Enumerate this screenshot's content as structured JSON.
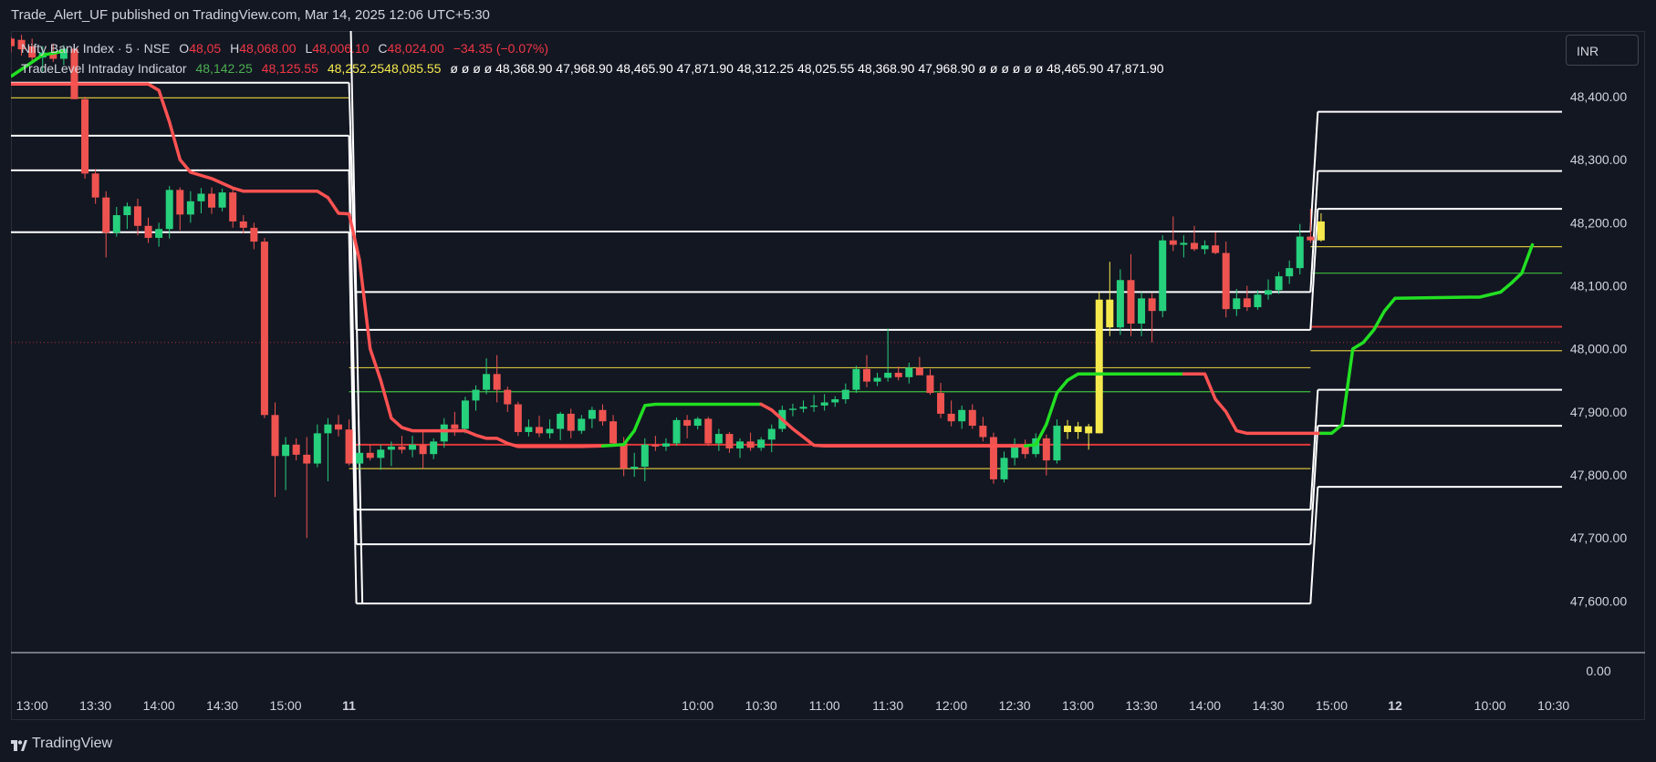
{
  "header": {
    "publish_line": "Trade_Alert_UF published on TradingView.com, Mar 14, 2025 12:06 UTC+5:30"
  },
  "legend": {
    "symbol": "Nifty Bank Index · 5 · NSE",
    "open_label": "O",
    "open_value": "48,05",
    "high_label": "H",
    "high_value": "48,068.00",
    "low_label": "L",
    "low_value": "48,006.10",
    "close_label": "C",
    "close_value": "48,024.00",
    "change": "−34.35 (−0.07%)",
    "indicator_name": "TradeLevel Intraday Indicator",
    "indicator_v1": "48,142.25",
    "indicator_v2": "48,125.55",
    "indicator_v3": "48,252.25",
    "indicator_v4": "48,085.55",
    "indicator_tail": "ø ø ø ø 48,368.90 47,968.90 48,465.90 47,871.90 48,312.25 48,025.55 48,368.90 47,968.90 ø ø ø ø ø ø 48,465.90 47,871.90"
  },
  "currency_button": {
    "label": "INR"
  },
  "footer": {
    "brand": "TradingView"
  },
  "colors": {
    "background": "#131722",
    "up_candle": "#26d07c",
    "down_candle": "#ef5350",
    "yellow_candle": "#f5e94e",
    "red_line": "#ff5252",
    "green_line": "#22e022",
    "level_white": "#ffffff",
    "level_yellow": "#d4c13a",
    "level_green": "#3fbf3f",
    "level_red": "#e03838"
  },
  "chart_data": {
    "type": "candlestick",
    "title": "",
    "xlabel": "",
    "ylabel": "",
    "ylim": [
      47500,
      48455
    ],
    "y_ticks": [
      48400,
      48300,
      48200,
      48100,
      48000,
      47900,
      47800,
      47700,
      47600
    ],
    "y_tick_labels": [
      "48,400.00",
      "48,300.00",
      "48,200.00",
      "48,100.00",
      "48,000.00",
      "47,900.00",
      "47,800.00",
      "47,700.00",
      "47,600.00"
    ],
    "indicator_pane_label": "0.00",
    "x_ticks": [
      {
        "label": "13:00",
        "bar": -54
      },
      {
        "label": "13:30",
        "bar": -48
      },
      {
        "label": "14:00",
        "bar": -42
      },
      {
        "label": "14:30",
        "bar": -36
      },
      {
        "label": "15:00",
        "bar": -30
      },
      {
        "label": "11",
        "bar": -24
      },
      {
        "label": "10:00",
        "bar": 9
      },
      {
        "label": "10:30",
        "bar": 15
      },
      {
        "label": "11:00",
        "bar": 21
      },
      {
        "label": "11:30",
        "bar": 27
      },
      {
        "label": "12:00",
        "bar": 33
      },
      {
        "label": "12:30",
        "bar": 39
      },
      {
        "label": "13:00",
        "bar": 45
      },
      {
        "label": "13:30",
        "bar": 51
      },
      {
        "label": "14:00",
        "bar": 57
      },
      {
        "label": "14:30",
        "bar": 63
      },
      {
        "label": "15:00",
        "bar": 69
      },
      {
        "label": "12",
        "bar": 75
      },
      {
        "label": "10:00",
        "bar": 84
      },
      {
        "label": "10:30",
        "bar": 90
      }
    ],
    "bar_first": -56,
    "bar_last": 93,
    "candles": [
      {
        "o": 48492,
        "h": 48495,
        "l": 48470,
        "c": 48480
      },
      {
        "o": 48490,
        "h": 48498,
        "l": 48465,
        "c": 48475
      },
      {
        "o": 48480,
        "h": 48492,
        "l": 48455,
        "c": 48462
      },
      {
        "o": 48462,
        "h": 48480,
        "l": 48440,
        "c": 48470
      },
      {
        "o": 48470,
        "h": 48484,
        "l": 48455,
        "c": 48460
      },
      {
        "o": 48460,
        "h": 48482,
        "l": 48450,
        "c": 48476
      },
      {
        "o": 48476,
        "h": 48484,
        "l": 48396,
        "c": 48396
      },
      {
        "o": 48396,
        "h": 48400,
        "l": 48270,
        "c": 48278
      },
      {
        "o": 48278,
        "h": 48285,
        "l": 48230,
        "c": 48240
      },
      {
        "o": 48240,
        "h": 48250,
        "l": 48145,
        "c": 48184
      },
      {
        "o": 48184,
        "h": 48225,
        "l": 48178,
        "c": 48212
      },
      {
        "o": 48212,
        "h": 48232,
        "l": 48190,
        "c": 48226
      },
      {
        "o": 48226,
        "h": 48238,
        "l": 48180,
        "c": 48195
      },
      {
        "o": 48195,
        "h": 48208,
        "l": 48168,
        "c": 48176
      },
      {
        "o": 48176,
        "h": 48200,
        "l": 48162,
        "c": 48190
      },
      {
        "o": 48190,
        "h": 48258,
        "l": 48175,
        "c": 48252
      },
      {
        "o": 48252,
        "h": 48256,
        "l": 48188,
        "c": 48213
      },
      {
        "o": 48213,
        "h": 48250,
        "l": 48200,
        "c": 48234
      },
      {
        "o": 48234,
        "h": 48255,
        "l": 48215,
        "c": 48246
      },
      {
        "o": 48246,
        "h": 48256,
        "l": 48214,
        "c": 48224
      },
      {
        "o": 48224,
        "h": 48254,
        "l": 48218,
        "c": 48248
      },
      {
        "o": 48248,
        "h": 48253,
        "l": 48192,
        "c": 48202
      },
      {
        "o": 48202,
        "h": 48212,
        "l": 48183,
        "c": 48192
      },
      {
        "o": 48192,
        "h": 48200,
        "l": 48158,
        "c": 48170
      },
      {
        "o": 48170,
        "h": 48176,
        "l": 47890,
        "c": 47895
      },
      {
        "o": 47895,
        "h": 47915,
        "l": 47765,
        "c": 47830
      },
      {
        "o": 47830,
        "h": 47860,
        "l": 47776,
        "c": 47848
      },
      {
        "o": 47848,
        "h": 47858,
        "l": 47823,
        "c": 47832
      },
      {
        "o": 47832,
        "h": 47860,
        "l": 47700,
        "c": 47818
      },
      {
        "o": 47818,
        "h": 47880,
        "l": 47812,
        "c": 47866
      },
      {
        "o": 47866,
        "h": 47890,
        "l": 47790,
        "c": 47880
      },
      {
        "o": 47880,
        "h": 47895,
        "l": 47861,
        "c": 47872
      },
      {
        "o": 47872,
        "h": 47888,
        "l": 47815,
        "c": 47818
      },
      {
        "o": 47818,
        "h": 47848,
        "l": 47808,
        "c": 47835
      },
      {
        "o": 47835,
        "h": 47848,
        "l": 47823,
        "c": 47827
      },
      {
        "o": 47827,
        "h": 47848,
        "l": 47808,
        "c": 47840
      },
      {
        "o": 47840,
        "h": 47853,
        "l": 47814,
        "c": 47845
      },
      {
        "o": 47845,
        "h": 47862,
        "l": 47834,
        "c": 47840
      },
      {
        "o": 47840,
        "h": 47862,
        "l": 47828,
        "c": 47848
      },
      {
        "o": 47848,
        "h": 47868,
        "l": 47810,
        "c": 47833
      },
      {
        "o": 47833,
        "h": 47858,
        "l": 47825,
        "c": 47853
      },
      {
        "o": 47853,
        "h": 47890,
        "l": 47843,
        "c": 47880
      },
      {
        "o": 47880,
        "h": 47900,
        "l": 47862,
        "c": 47873
      },
      {
        "o": 47873,
        "h": 47924,
        "l": 47866,
        "c": 47918
      },
      {
        "o": 47918,
        "h": 47942,
        "l": 47902,
        "c": 47935
      },
      {
        "o": 47935,
        "h": 47985,
        "l": 47928,
        "c": 47960
      },
      {
        "o": 47960,
        "h": 47990,
        "l": 47915,
        "c": 47935
      },
      {
        "o": 47935,
        "h": 47940,
        "l": 47900,
        "c": 47912
      },
      {
        "o": 47912,
        "h": 47916,
        "l": 47862,
        "c": 47868
      },
      {
        "o": 47868,
        "h": 47888,
        "l": 47861,
        "c": 47876
      },
      {
        "o": 47876,
        "h": 47894,
        "l": 47860,
        "c": 47866
      },
      {
        "o": 47866,
        "h": 47888,
        "l": 47858,
        "c": 47873
      },
      {
        "o": 47873,
        "h": 47900,
        "l": 47855,
        "c": 47897
      },
      {
        "o": 47897,
        "h": 47905,
        "l": 47858,
        "c": 47870
      },
      {
        "o": 47870,
        "h": 47895,
        "l": 47865,
        "c": 47889
      },
      {
        "o": 47889,
        "h": 47908,
        "l": 47874,
        "c": 47903
      },
      {
        "o": 47903,
        "h": 47912,
        "l": 47878,
        "c": 47885
      },
      {
        "o": 47885,
        "h": 47895,
        "l": 47845,
        "c": 47850
      },
      {
        "o": 47850,
        "h": 47860,
        "l": 47798,
        "c": 47810
      },
      {
        "o": 47810,
        "h": 47835,
        "l": 47797,
        "c": 47813
      },
      {
        "o": 47813,
        "h": 47858,
        "l": 47790,
        "c": 47848
      },
      {
        "o": 47848,
        "h": 47862,
        "l": 47838,
        "c": 47845
      },
      {
        "o": 47845,
        "h": 47858,
        "l": 47838,
        "c": 47850
      },
      {
        "o": 47850,
        "h": 47891,
        "l": 47846,
        "c": 47887
      },
      {
        "o": 47887,
        "h": 47895,
        "l": 47858,
        "c": 47878
      },
      {
        "o": 47878,
        "h": 47892,
        "l": 47872,
        "c": 47889
      },
      {
        "o": 47889,
        "h": 47892,
        "l": 47846,
        "c": 47850
      },
      {
        "o": 47850,
        "h": 47873,
        "l": 47838,
        "c": 47865
      },
      {
        "o": 47865,
        "h": 47868,
        "l": 47835,
        "c": 47842
      },
      {
        "o": 47842,
        "h": 47858,
        "l": 47827,
        "c": 47853
      },
      {
        "o": 47853,
        "h": 47867,
        "l": 47838,
        "c": 47843
      },
      {
        "o": 47843,
        "h": 47860,
        "l": 47838,
        "c": 47856
      },
      {
        "o": 47856,
        "h": 47880,
        "l": 47836,
        "c": 47873
      },
      {
        "o": 47873,
        "h": 47910,
        "l": 47868,
        "c": 47903
      },
      {
        "o": 47903,
        "h": 47913,
        "l": 47893,
        "c": 47905
      },
      {
        "o": 47905,
        "h": 47918,
        "l": 47899,
        "c": 47908
      },
      {
        "o": 47908,
        "h": 47927,
        "l": 47900,
        "c": 47910
      },
      {
        "o": 47910,
        "h": 47928,
        "l": 47902,
        "c": 47915
      },
      {
        "o": 47915,
        "h": 47925,
        "l": 47908,
        "c": 47920
      },
      {
        "o": 47920,
        "h": 47945,
        "l": 47913,
        "c": 47935
      },
      {
        "o": 47935,
        "h": 47973,
        "l": 47930,
        "c": 47968
      },
      {
        "o": 47968,
        "h": 47990,
        "l": 47939,
        "c": 47948
      },
      {
        "o": 47948,
        "h": 47962,
        "l": 47941,
        "c": 47954
      },
      {
        "o": 47954,
        "h": 48032,
        "l": 47948,
        "c": 47962
      },
      {
        "o": 47962,
        "h": 47972,
        "l": 47950,
        "c": 47955
      },
      {
        "o": 47955,
        "h": 47978,
        "l": 47945,
        "c": 47970
      },
      {
        "o": 47970,
        "h": 47987,
        "l": 47962,
        "c": 47958
      },
      {
        "o": 47958,
        "h": 47968,
        "l": 47927,
        "c": 47930
      },
      {
        "o": 47930,
        "h": 47946,
        "l": 47890,
        "c": 47897
      },
      {
        "o": 47897,
        "h": 47918,
        "l": 47877,
        "c": 47885
      },
      {
        "o": 47885,
        "h": 47910,
        "l": 47873,
        "c": 47903
      },
      {
        "o": 47903,
        "h": 47912,
        "l": 47873,
        "c": 47878
      },
      {
        "o": 47878,
        "h": 47892,
        "l": 47853,
        "c": 47860
      },
      {
        "o": 47860,
        "h": 47867,
        "l": 47786,
        "c": 47793
      },
      {
        "o": 47793,
        "h": 47837,
        "l": 47788,
        "c": 47827
      },
      {
        "o": 47827,
        "h": 47858,
        "l": 47815,
        "c": 47848
      },
      {
        "o": 47848,
        "h": 47856,
        "l": 47826,
        "c": 47833
      },
      {
        "o": 47833,
        "h": 47866,
        "l": 47828,
        "c": 47858
      },
      {
        "o": 47858,
        "h": 47864,
        "l": 47799,
        "c": 47823
      },
      {
        "o": 47823,
        "h": 47888,
        "l": 47818,
        "c": 47878
      },
      {
        "o": 47878,
        "h": 47887,
        "l": 47857,
        "c": 47868
      },
      {
        "o": 47868,
        "h": 47884,
        "l": 47857,
        "c": 47877
      },
      {
        "o": 47877,
        "h": 47881,
        "l": 47840,
        "c": 47866
      },
      {
        "o": 47866,
        "h": 48090,
        "l": 47866,
        "c": 48078
      },
      {
        "o": 48078,
        "h": 48138,
        "l": 48020,
        "c": 48034
      },
      {
        "o": 48034,
        "h": 48126,
        "l": 48022,
        "c": 48109
      },
      {
        "o": 48109,
        "h": 48150,
        "l": 48020,
        "c": 48040
      },
      {
        "o": 48040,
        "h": 48090,
        "l": 48020,
        "c": 48080
      },
      {
        "o": 48080,
        "h": 48088,
        "l": 48010,
        "c": 48060
      },
      {
        "o": 48060,
        "h": 48180,
        "l": 48050,
        "c": 48172
      },
      {
        "o": 48172,
        "h": 48210,
        "l": 48155,
        "c": 48165
      },
      {
        "o": 48165,
        "h": 48180,
        "l": 48145,
        "c": 48168
      },
      {
        "o": 48168,
        "h": 48195,
        "l": 48155,
        "c": 48158
      },
      {
        "o": 48158,
        "h": 48172,
        "l": 48150,
        "c": 48164
      },
      {
        "o": 48164,
        "h": 48185,
        "l": 48150,
        "c": 48152
      },
      {
        "o": 48152,
        "h": 48170,
        "l": 48050,
        "c": 48063
      },
      {
        "o": 48063,
        "h": 48095,
        "l": 48052,
        "c": 48080
      },
      {
        "o": 48080,
        "h": 48100,
        "l": 48060,
        "c": 48066
      },
      {
        "o": 48066,
        "h": 48093,
        "l": 48062,
        "c": 48086
      },
      {
        "o": 48086,
        "h": 48110,
        "l": 48078,
        "c": 48093
      },
      {
        "o": 48093,
        "h": 48122,
        "l": 48087,
        "c": 48115
      },
      {
        "o": 48115,
        "h": 48140,
        "l": 48103,
        "c": 48128
      },
      {
        "o": 48128,
        "h": 48198,
        "l": 48118,
        "c": 48178
      },
      {
        "o": 48178,
        "h": 48222,
        "l": 48168,
        "c": 48172
      },
      {
        "o": 48172,
        "h": 48215,
        "l": 48170,
        "c": 48202
      }
    ],
    "red_trail": [
      [
        -56,
        48420
      ],
      [
        -43,
        48420
      ],
      [
        -42,
        48410
      ],
      [
        -41,
        48360
      ],
      [
        -40,
        48300
      ],
      [
        -39,
        48280
      ],
      [
        -37,
        48270
      ],
      [
        -35,
        48255
      ],
      [
        -34,
        48250
      ],
      [
        -33,
        48250
      ],
      [
        -27,
        48250
      ],
      [
        -26,
        48240
      ],
      [
        -25,
        48215
      ],
      [
        -24,
        48214
      ],
      [
        -23,
        48140
      ],
      [
        -22,
        48000
      ],
      [
        -21,
        47950
      ],
      [
        -20,
        47890
      ],
      [
        -19,
        47875
      ],
      [
        -18,
        47870
      ],
      [
        -13,
        47870
      ],
      [
        -12,
        47863
      ],
      [
        -11,
        47858
      ],
      [
        -10,
        47858
      ],
      [
        -9,
        47850
      ],
      [
        -8,
        47845
      ],
      [
        -2,
        47845
      ],
      [
        0,
        47846
      ]
    ],
    "green_trail_1": [
      [
        0,
        47846
      ],
      [
        2,
        47848
      ],
      [
        3,
        47870
      ],
      [
        4,
        47910
      ],
      [
        5,
        47912
      ],
      [
        15,
        47912
      ]
    ],
    "red_trail_2": [
      [
        15,
        47912
      ],
      [
        16,
        47903
      ],
      [
        17,
        47888
      ],
      [
        18,
        47873
      ],
      [
        19,
        47860
      ],
      [
        20,
        47847
      ],
      [
        21,
        47846
      ],
      [
        40,
        47846
      ]
    ],
    "green_trail_2": [
      [
        40,
        47846
      ],
      [
        41,
        47848
      ],
      [
        42,
        47880
      ],
      [
        43,
        47930
      ],
      [
        44,
        47950
      ],
      [
        45,
        47960
      ],
      [
        55,
        47960
      ]
    ],
    "red_trail_3": [
      [
        55,
        47960
      ],
      [
        57,
        47960
      ],
      [
        58,
        47920
      ],
      [
        59,
        47900
      ],
      [
        60,
        47870
      ],
      [
        61,
        47866
      ],
      [
        68,
        47866
      ]
    ],
    "green_trail_3": [
      [
        68,
        47866
      ],
      [
        69,
        47866
      ],
      [
        70,
        47880
      ],
      [
        71,
        48000
      ],
      [
        72,
        48010
      ],
      [
        73,
        48030
      ],
      [
        74,
        48060
      ],
      [
        75,
        48080
      ],
      [
        82,
        48082
      ],
      [
        83,
        48082
      ],
      [
        85,
        48090
      ],
      [
        86,
        48104
      ],
      [
        87,
        48120
      ],
      [
        88,
        48165
      ]
    ],
    "white_levels": [
      {
        "from": -56,
        "to": -24,
        "values": [
          48422,
          48338,
          48283,
          48185
        ]
      },
      {
        "from": -24,
        "to": 67,
        "values": [
          48186,
          48090,
          48030,
          47745,
          47690,
          47596
        ]
      },
      {
        "from": 67,
        "to": 93,
        "values": [
          48376,
          48282,
          48222,
          47935,
          47878,
          47781
        ]
      }
    ],
    "other_levels": [
      {
        "color": "yellow",
        "from": -56,
        "to": -24,
        "value": 48398
      },
      {
        "color": "yellow",
        "from": -24,
        "to": 67,
        "value": 47970
      },
      {
        "color": "yellow",
        "from": -24,
        "to": 67,
        "value": 47810
      },
      {
        "color": "green",
        "from": -24,
        "to": 67,
        "value": 47932
      },
      {
        "color": "red",
        "from": -24,
        "to": 67,
        "value": 47848
      },
      {
        "color": "yellow",
        "from": 67,
        "to": 93,
        "value": 48162
      },
      {
        "color": "yellow",
        "from": 67,
        "to": 93,
        "value": 47997
      },
      {
        "color": "green",
        "from": 67,
        "to": 93,
        "value": 48120
      },
      {
        "color": "red",
        "from": 67,
        "to": 93,
        "value": 48035
      }
    ],
    "previous_close": 48010
  }
}
